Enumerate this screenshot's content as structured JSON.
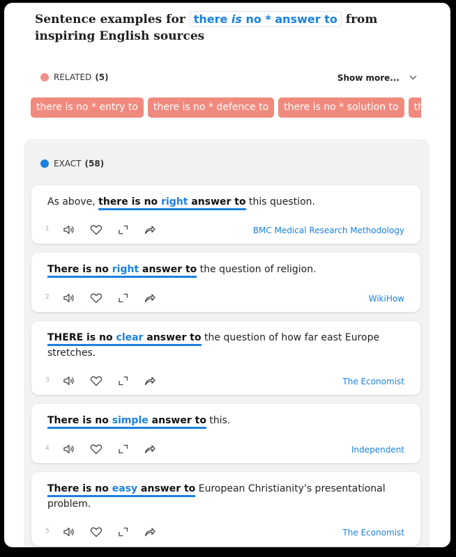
{
  "header": {
    "prefix": "Sentence examples for",
    "query_pre": "there ",
    "query_italic": "is",
    "query_post": " no * answer to",
    "suffix": "from inspiring English sources"
  },
  "related": {
    "label": "RELATED",
    "count": "(5)",
    "show_more": "Show more...",
    "chips": [
      "there is no * entry to",
      "there is no * defence to",
      "there is no * solution to",
      "there"
    ]
  },
  "exact": {
    "label": "EXACT",
    "count": "(58)"
  },
  "examples": [
    {
      "num": "1",
      "pre": "As above, ",
      "hl_a": "there is no ",
      "kw": "right",
      "hl_b": " answer to",
      "post": " this question.",
      "source": "BMC Medical Research Methodology"
    },
    {
      "num": "2",
      "pre": "",
      "hl_a": "There is no ",
      "kw": "right",
      "hl_b": " answer to",
      "post": " the question of religion.",
      "source": "WikiHow"
    },
    {
      "num": "3",
      "pre": "",
      "hl_a": "THERE is no ",
      "kw": "clear",
      "hl_b": " answer to",
      "post": " the question of how far east Europe stretches.",
      "source": "The Economist"
    },
    {
      "num": "4",
      "pre": "",
      "hl_a": "There is no ",
      "kw": "simple",
      "hl_b": " answer to",
      "post": " this.",
      "source": "Independent"
    },
    {
      "num": "5",
      "pre": "",
      "hl_a": "There is no ",
      "kw": "easy",
      "hl_b": " answer to",
      "post": " European Christianity's presentational problem.",
      "source": "The Economist"
    }
  ],
  "icons": {
    "listen": "speaker-icon",
    "favorite": "heart-icon",
    "expand": "expand-icon",
    "share": "share-icon"
  },
  "colors": {
    "accent_blue": "#1a80e0",
    "related_red": "#f18a7e"
  }
}
